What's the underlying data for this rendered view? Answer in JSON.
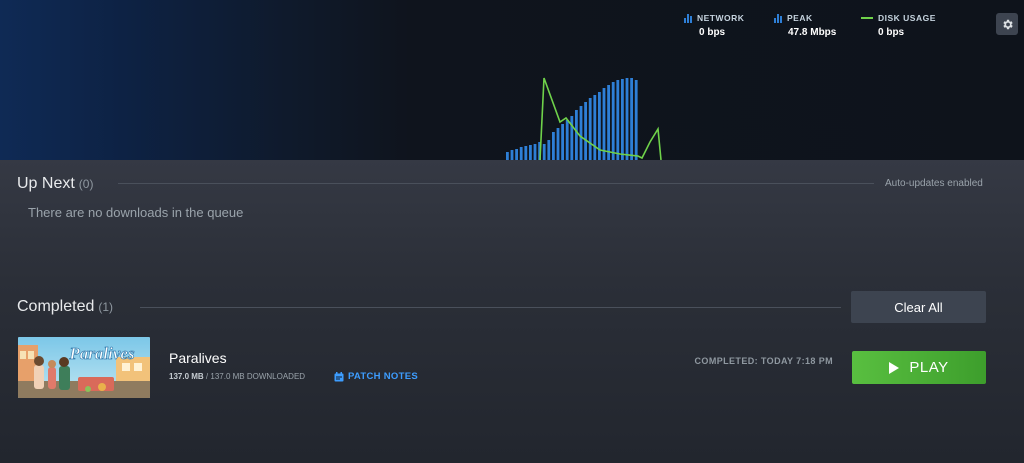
{
  "stats": {
    "network": {
      "label": "NETWORK",
      "value": "0 bps"
    },
    "peak": {
      "label": "PEAK",
      "value": "47.8 Mbps"
    },
    "disk": {
      "label": "DISK USAGE",
      "value": "0 bps"
    }
  },
  "colors": {
    "network_bars": "#2e7fd6",
    "disk_line": "#6fd24a",
    "play_button": "#59bf40",
    "patch_notes": "#3d9dff"
  },
  "up_next": {
    "title": "Up Next",
    "count": "(0)",
    "auto_updates": "Auto-updates enabled",
    "empty_message": "There are no downloads in the queue"
  },
  "completed": {
    "title": "Completed",
    "count": "(1)",
    "clear_all_label": "Clear All",
    "items": [
      {
        "thumbnail_logo": "Paralives",
        "name": "Paralives",
        "size_done": "137.0 MB",
        "size_total": "/ 137.0 MB DOWNLOADED",
        "patch_notes_label": "PATCH NOTES",
        "completed_label": "COMPLETED: TODAY 7:18 PM",
        "play_label": "PLAY"
      }
    ]
  },
  "icons": {
    "settings": "gear-icon",
    "network": "network-bars-icon",
    "peak": "peak-bars-icon",
    "disk": "disk-line-icon",
    "patch_notes": "calendar-icon",
    "play": "play-icon"
  }
}
